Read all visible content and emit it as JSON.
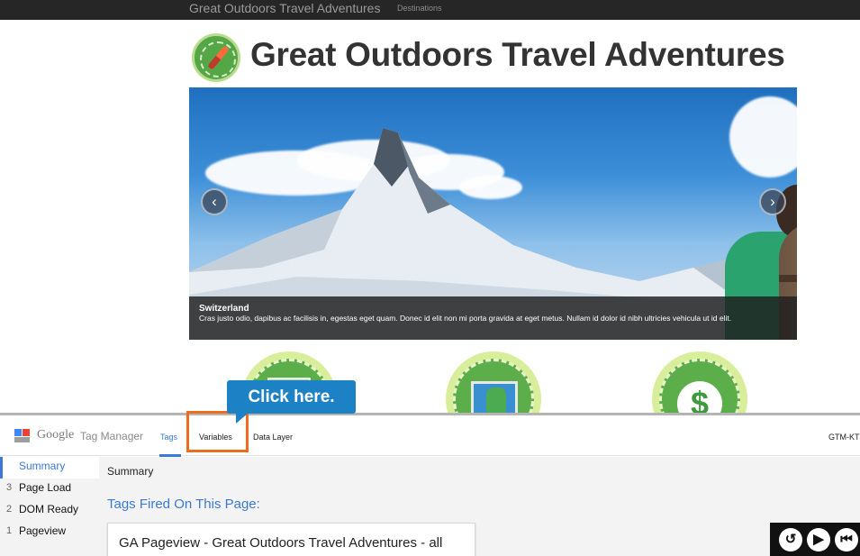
{
  "navbar": {
    "brand": "Great Outdoors Travel Adventures",
    "links": [
      "Destinations"
    ]
  },
  "site": {
    "title": "Great Outdoors Travel Adventures",
    "logo_icon": "compass-icon"
  },
  "carousel": {
    "prev_icon": "chevron-left-icon",
    "next_icon": "chevron-right-icon",
    "prev_glyph": "‹",
    "next_glyph": "›",
    "caption_title": "Switzerland",
    "caption_text": "Cras justo odio, dapibus ac facilisis in, egestas eget quam. Donec id elit non mi porta gravida at eget metus. Nullam id dolor id nibh ultricies vehicula ut id elit."
  },
  "features": [
    {
      "icon": "gallery-icon"
    },
    {
      "icon": "map-icon"
    },
    {
      "icon": "dollar-icon",
      "glyph": "$"
    }
  ],
  "tutorial": {
    "callout": "Click here."
  },
  "gtm": {
    "google": "Google",
    "product": "Tag Manager",
    "tabs": [
      "Tags",
      "Variables",
      "Data Layer"
    ],
    "container_id": "GTM-KT",
    "sidebar": [
      {
        "num": "",
        "label": "Summary"
      },
      {
        "num": "3",
        "label": "Page Load"
      },
      {
        "num": "2",
        "label": "DOM Ready"
      },
      {
        "num": "1",
        "label": "Pageview"
      }
    ],
    "main_title": "Summary",
    "section_title": "Tags Fired On This Page:",
    "fired_tags": [
      "GA Pageview - Great Outdoors Travel Adventures - all"
    ]
  },
  "player": {
    "replay": "↺",
    "play": "▶",
    "back": "⏮"
  },
  "colors": {
    "accent_blue": "#3b79d2",
    "callout_blue": "#1d82c5",
    "highlight_orange": "#ee6c1d",
    "navbar": "#262626"
  }
}
